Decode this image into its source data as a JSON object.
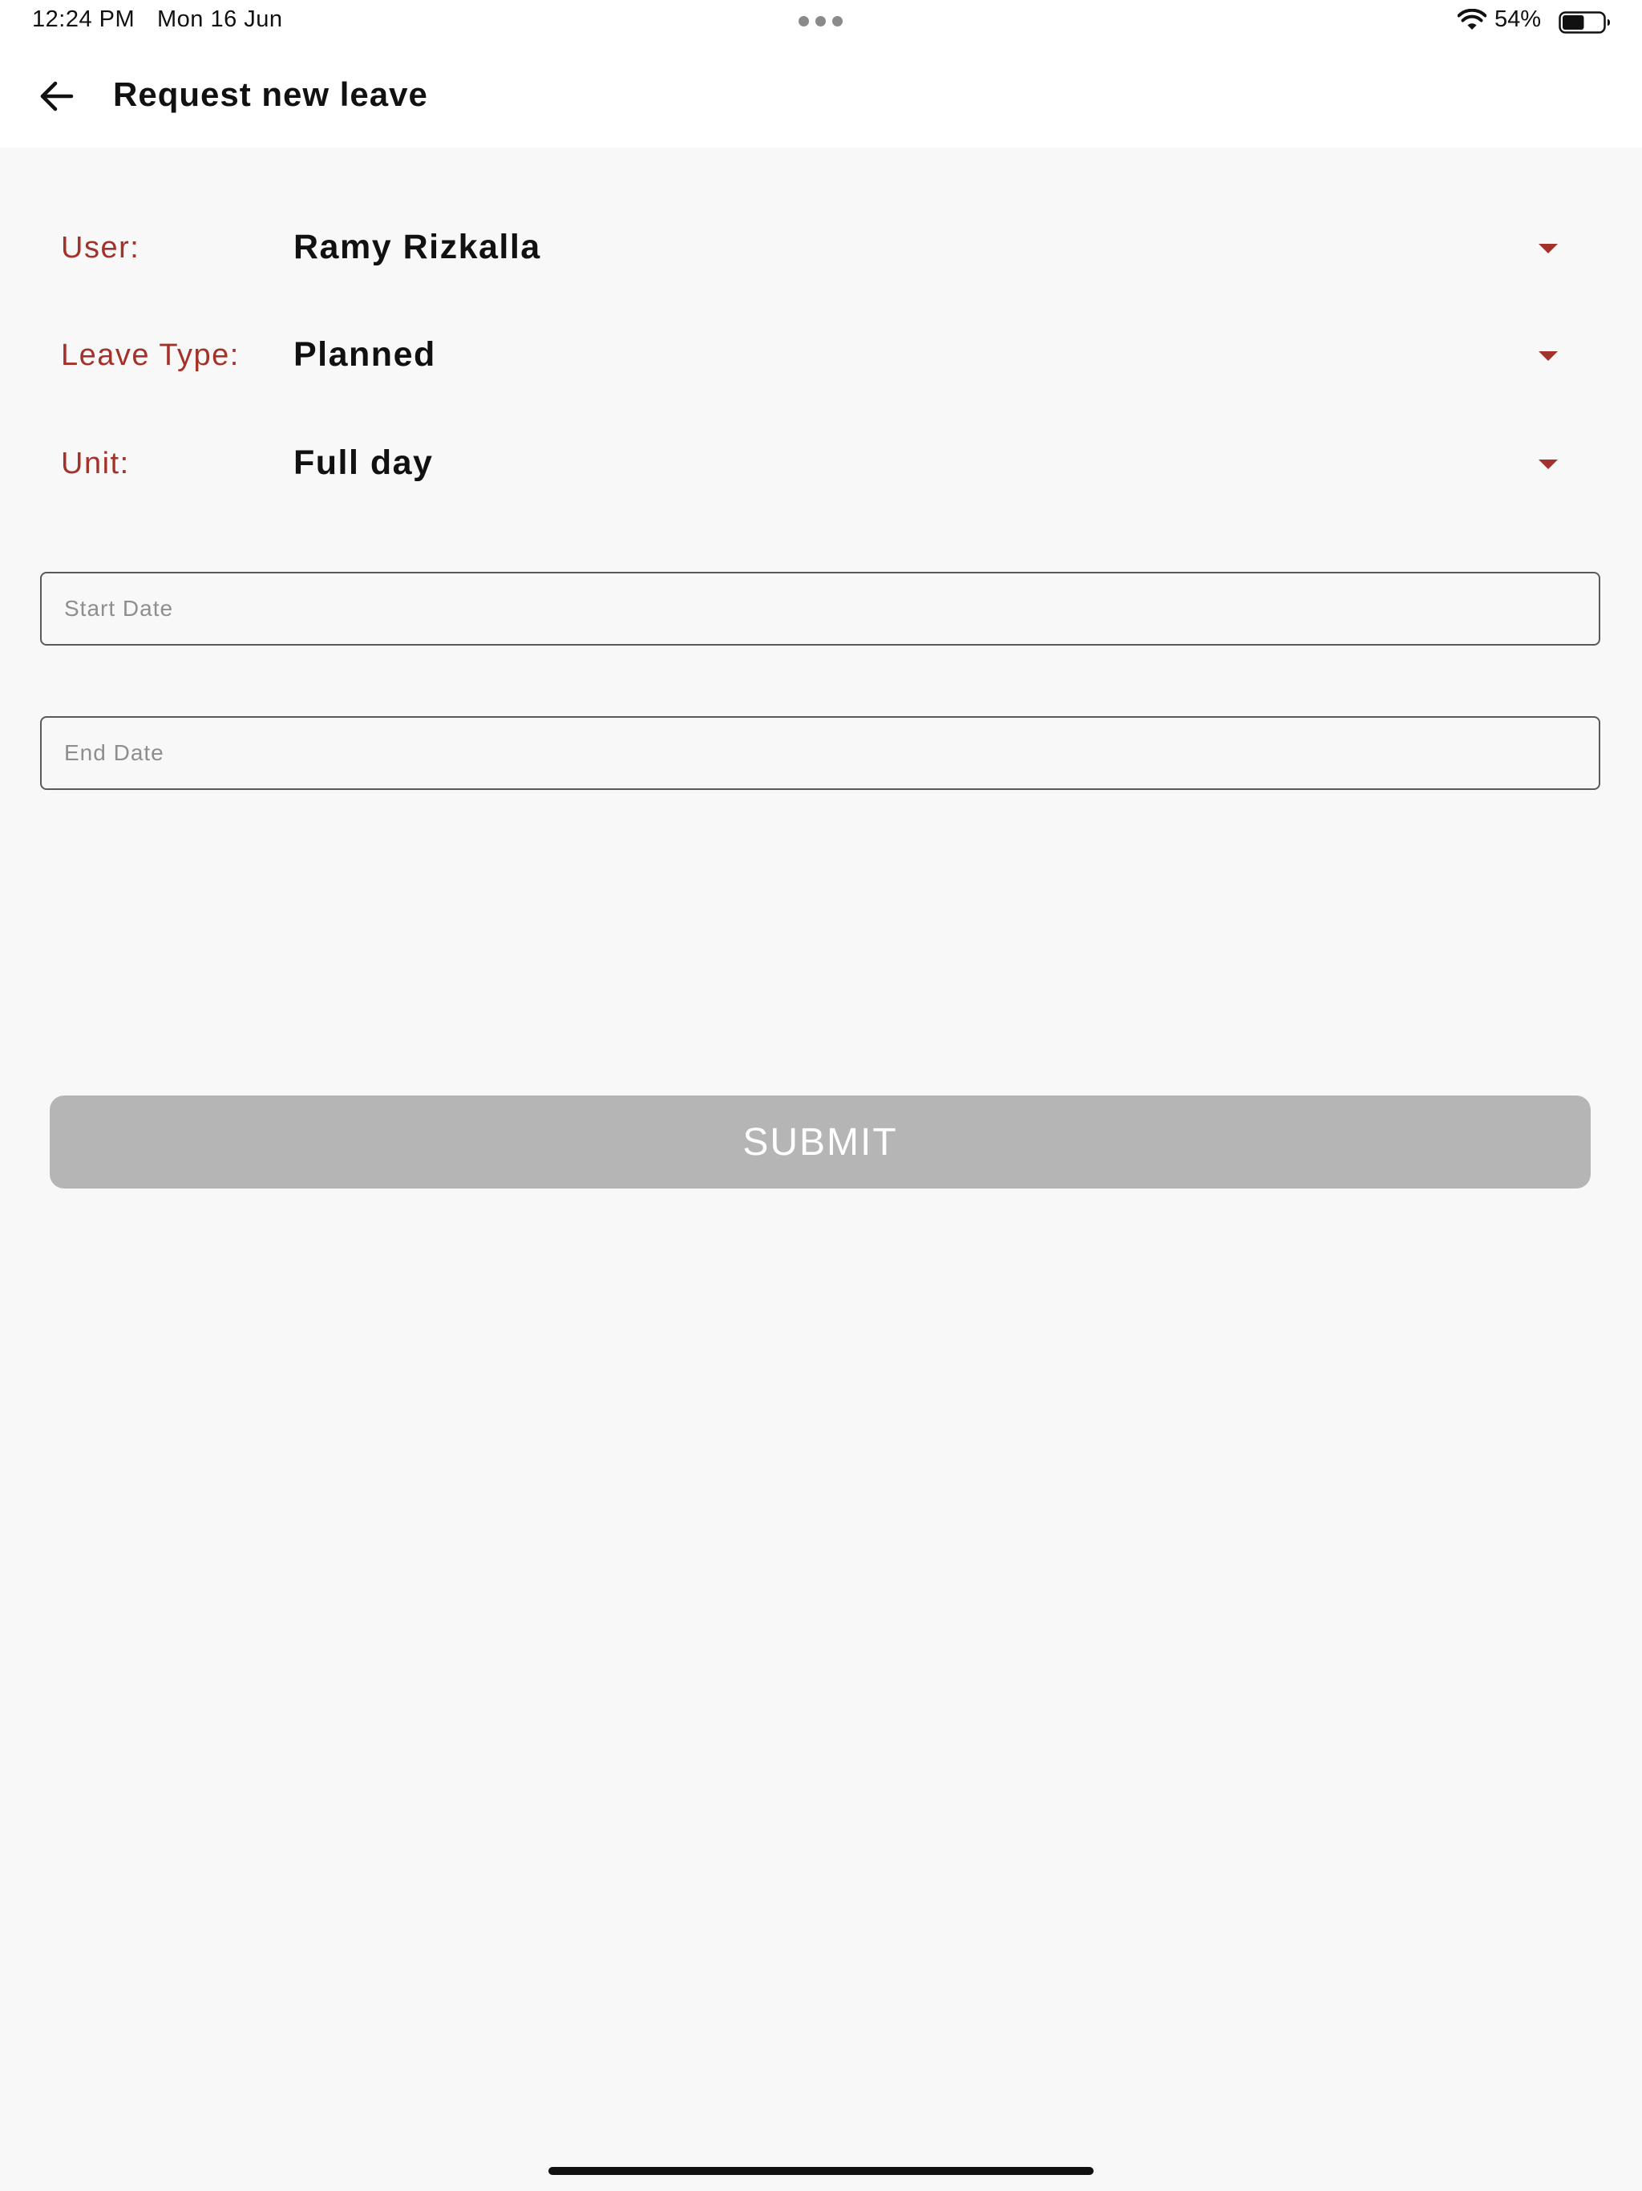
{
  "status_bar": {
    "time": "12:24 PM",
    "date": "Mon 16 Jun",
    "battery_percent": "54%",
    "battery_level": 0.54
  },
  "header": {
    "title": "Request new leave",
    "back_icon": "arrow-left-icon"
  },
  "form": {
    "user": {
      "label": "User:",
      "value": "Ramy Rizkalla"
    },
    "leave_type": {
      "label": "Leave Type:",
      "value": "Planned"
    },
    "unit": {
      "label": "Unit:",
      "value": "Full day"
    },
    "start_date": {
      "placeholder": "Start Date",
      "value": ""
    },
    "end_date": {
      "placeholder": "End Date",
      "value": ""
    },
    "submit_label": "SUBMIT"
  },
  "colors": {
    "accent": "#a3322a",
    "background": "#f8f8f8",
    "submit_disabled": "#b5b5b5"
  }
}
